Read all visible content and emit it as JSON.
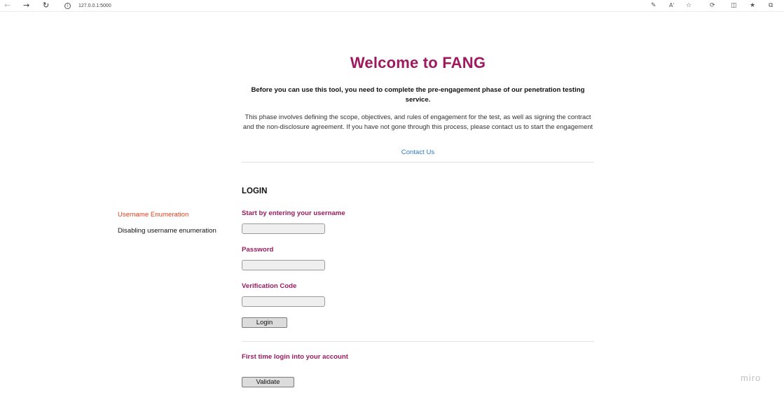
{
  "browser": {
    "back_icon": "arrow-left-icon",
    "forward_icon": "arrow-right-icon",
    "reload_icon": "reload-icon",
    "info_icon": "info-icon",
    "url": "127.0.0.1:5000",
    "right_icons": [
      "pen-icon",
      "read-aloud-icon",
      "star-icon",
      "extensions-icon",
      "split-screen-icon",
      "favorites-icon",
      "collections-icon"
    ]
  },
  "header": {
    "title": "Welcome to FANG",
    "lead": "Before you can use this tool, you need to complete the pre-engagement phase of our penetration testing service.",
    "description": "This phase involves defining the scope, objectives, and rules of engagement for the test, as well as signing the contract and the non-disclosure agreement. If you have not gone through this process, please contact us to start the engagement",
    "contact_link": "Contact Us"
  },
  "sidebar": {
    "title": "Username Enumeration",
    "subtitle": "Disabling username enumeration"
  },
  "login": {
    "heading": "LOGIN",
    "username_label": "Start by entering your username",
    "username_value": "",
    "password_label": "Password",
    "password_value": "",
    "verification_label": "Verification Code",
    "verification_value": "",
    "login_button": "Login"
  },
  "first_time": {
    "label": "First time login into your account",
    "validate_button": "Validate"
  },
  "watermark": "miro",
  "colors": {
    "accent": "#a01960",
    "label": "#9a1a5e",
    "link": "#2e7bbf",
    "side_title": "#e2401a"
  }
}
